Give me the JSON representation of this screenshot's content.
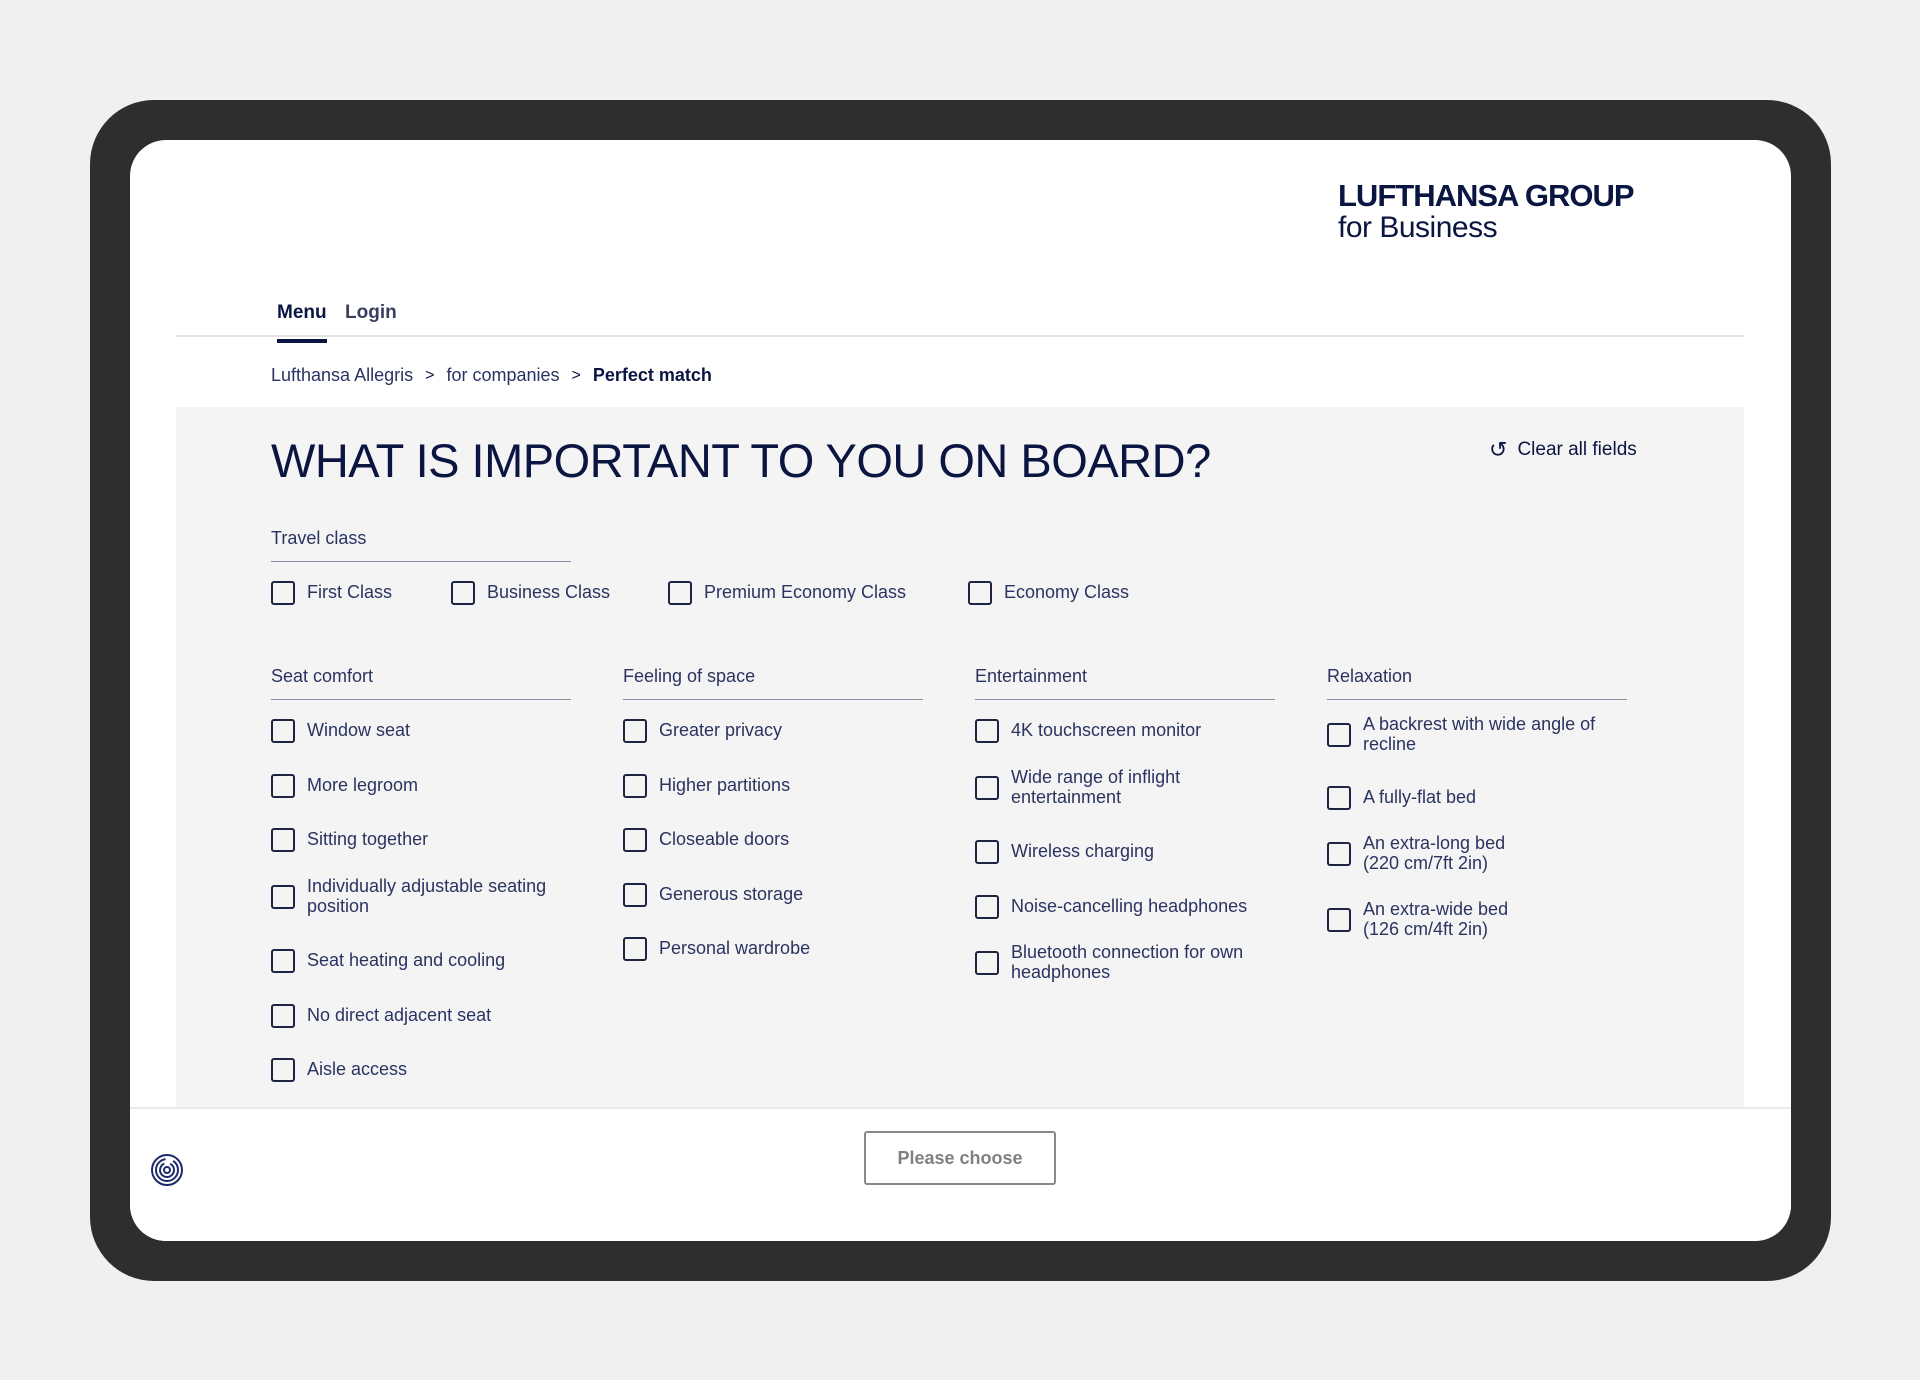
{
  "logo": {
    "line1": "LUFTHANSA GROUP",
    "line2": "for Business"
  },
  "nav": {
    "menu": "Menu",
    "login": "Login"
  },
  "breadcrumb": {
    "item1": "Lufthansa Allegris",
    "item2": "for companies",
    "current": "Perfect match",
    "separator": ">"
  },
  "heading": "WHAT IS IMPORTANT TO YOU ON BOARD?",
  "clear_all": "Clear all fields",
  "travel_class": {
    "label": "Travel class",
    "options": [
      "First Class",
      "Business Class",
      "Premium Economy Class",
      "Economy Class"
    ]
  },
  "seat_comfort": {
    "label": "Seat comfort",
    "options": [
      "Window seat",
      "More legroom",
      "Sitting together",
      "Individually adjustable seating position",
      "Seat heating and cooling",
      "No direct adjacent seat",
      "Aisle access"
    ]
  },
  "feeling_of_space": {
    "label": "Feeling of space",
    "options": [
      "Greater privacy",
      "Higher partitions",
      "Closeable doors",
      "Generous storage",
      "Personal wardrobe"
    ]
  },
  "entertainment": {
    "label": "Entertainment",
    "options": [
      "4K touchscreen monitor",
      "Wide range of inflight entertainment",
      "Wireless charging",
      "Noise-cancelling headphones",
      "Bluetooth connection for own headphones"
    ]
  },
  "relaxation": {
    "label": "Relaxation",
    "options": [
      "A backrest with wide angle of recline",
      "A fully-flat bed",
      "An extra-long bed (220 cm/7ft 2in)",
      "An extra-wide bed (126 cm/4ft 2in)"
    ]
  },
  "footer": {
    "button": "Please choose",
    "icon": "fingerprint-icon"
  }
}
